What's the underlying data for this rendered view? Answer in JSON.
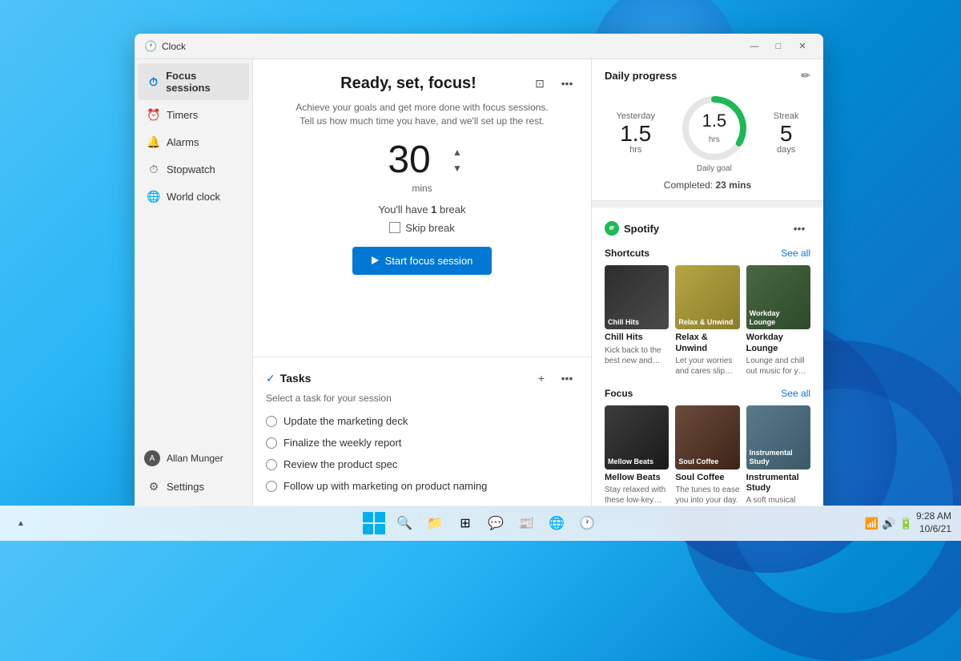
{
  "desktop": {
    "colors": {
      "bg_start": "#4fc3f7",
      "bg_end": "#1565c0",
      "accent": "#0078d4"
    }
  },
  "window": {
    "title": "Clock",
    "titlebar": {
      "title": "Clock",
      "minimize": "—",
      "maximize": "□",
      "close": "✕"
    }
  },
  "sidebar": {
    "items": [
      {
        "label": "Focus sessions",
        "active": true,
        "icon": "⏱"
      },
      {
        "label": "Timers",
        "active": false,
        "icon": "⏰"
      },
      {
        "label": "Alarms",
        "active": false,
        "icon": "🔔"
      },
      {
        "label": "Stopwatch",
        "active": false,
        "icon": "⏱"
      },
      {
        "label": "World clock",
        "active": false,
        "icon": "🌐"
      }
    ],
    "user": {
      "name": "Allan Munger",
      "settings": "Settings"
    }
  },
  "focus": {
    "heading": "Ready, set, focus!",
    "subtitle_line1": "Achieve your goals and get more done with focus sessions.",
    "subtitle_line2": "Tell us how much time you have, and we'll set up the rest.",
    "timer": {
      "value": "30",
      "unit": "mins"
    },
    "break_text_prefix": "You'll have",
    "break_count": "1",
    "break_text_suffix": "break",
    "skip_label": "Skip break",
    "start_button": "Start focus session"
  },
  "tasks": {
    "title": "Tasks",
    "subtitle": "Select a task for your session",
    "items": [
      {
        "label": "Update the marketing deck"
      },
      {
        "label": "Finalize the weekly report"
      },
      {
        "label": "Review the product spec"
      },
      {
        "label": "Follow up with marketing on product naming"
      }
    ]
  },
  "daily_progress": {
    "title": "Daily progress",
    "yesterday": {
      "label": "Yesterday",
      "value": "1.5",
      "unit": "hrs"
    },
    "daily_goal": {
      "label": "Daily goal",
      "value": "1.5",
      "unit": "hrs",
      "ring_label": "Daily goal"
    },
    "streak": {
      "label": "Streak",
      "value": "5",
      "unit": "days"
    },
    "completed_prefix": "Completed:",
    "completed_value": "23 mins"
  },
  "spotify": {
    "title": "Spotify",
    "shortcuts_label": "Shortcuts",
    "see_all_1": "See all",
    "focus_label": "Focus",
    "see_all_2": "See all",
    "shortcuts": [
      {
        "name": "Chill Hits",
        "desc": "Kick back to the best new and rece...",
        "thumb_class": "thumb-chill",
        "thumb_label": "Chill Hits"
      },
      {
        "name": "Relax & Unwind",
        "desc": "Let your worries and cares slip away.",
        "thumb_class": "thumb-relax",
        "thumb_label": "Relax & Unwind"
      },
      {
        "name": "Workday Lounge",
        "desc": "Lounge and chill out music for your wor...",
        "thumb_class": "thumb-workday",
        "thumb_label": "Workday Lounge"
      }
    ],
    "focus_items": [
      {
        "name": "Mellow Beats",
        "desc": "Stay relaxed with these low-key beat...",
        "thumb_class": "thumb-mellow",
        "thumb_label": "Mellow Beats"
      },
      {
        "name": "Soul Coffee",
        "desc": "The tunes to ease you into your day.",
        "thumb_class": "thumb-coffee",
        "thumb_label": "Soul Coffee"
      },
      {
        "name": "Instrumental Study",
        "desc": "A soft musical backdrop for your...",
        "thumb_class": "thumb-instrumental",
        "thumb_label": "Instrumental Study"
      }
    ]
  },
  "taskbar": {
    "datetime": {
      "date": "10/6/21",
      "time": "9:28 AM"
    }
  }
}
